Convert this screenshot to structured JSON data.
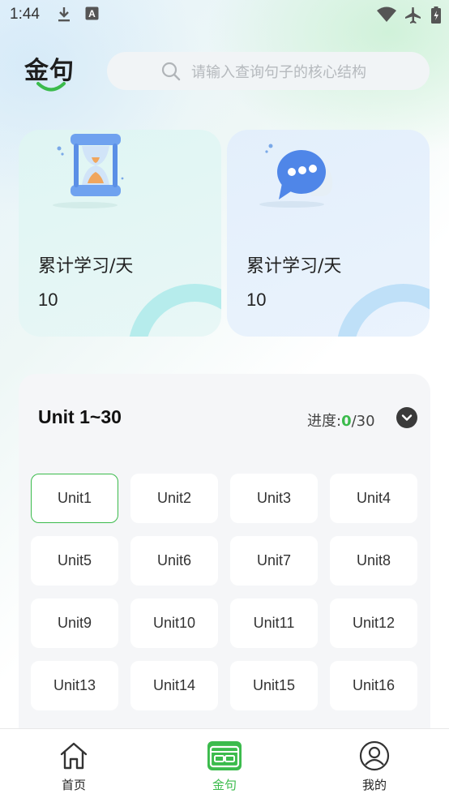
{
  "status_bar": {
    "time": "1:44",
    "left_icons": [
      "download-icon",
      "text-a-icon"
    ],
    "right_icons": [
      "wifi-icon",
      "airplane-icon",
      "battery-icon"
    ]
  },
  "header": {
    "logo_text": "金句",
    "search": {
      "placeholder": "请输入查询句子的核心结构",
      "icon": "search-icon"
    }
  },
  "stats": [
    {
      "label": "累计学习/天",
      "value": "10",
      "illustration": "hourglass-icon"
    },
    {
      "label": "累计学习/天",
      "value": "10",
      "illustration": "chat-bubble-icon"
    }
  ],
  "units_section": {
    "title": "Unit 1~30",
    "progress_label": "进度:",
    "progress_done": "0",
    "progress_total": "/30",
    "progress_fraction": 0,
    "collapse_icon": "chevron-down-icon",
    "units": [
      "Unit1",
      "Unit2",
      "Unit3",
      "Unit4",
      "Unit5",
      "Unit6",
      "Unit7",
      "Unit8",
      "Unit9",
      "Unit10",
      "Unit11",
      "Unit12",
      "Unit13",
      "Unit14",
      "Unit15",
      "Unit16"
    ],
    "selected_unit": "Unit1"
  },
  "bottom_nav": {
    "items": [
      {
        "label": "首页",
        "icon": "home-icon",
        "active": false
      },
      {
        "label": "金句",
        "icon": "card-icon",
        "active": true
      },
      {
        "label": "我的",
        "icon": "profile-icon",
        "active": false
      }
    ]
  },
  "colors": {
    "accent": "#3bbb4c",
    "card_left_bg": "#dff5f3",
    "card_right_bg": "#e3effb",
    "text_primary": "#222222",
    "placeholder": "#b5b9bd"
  }
}
